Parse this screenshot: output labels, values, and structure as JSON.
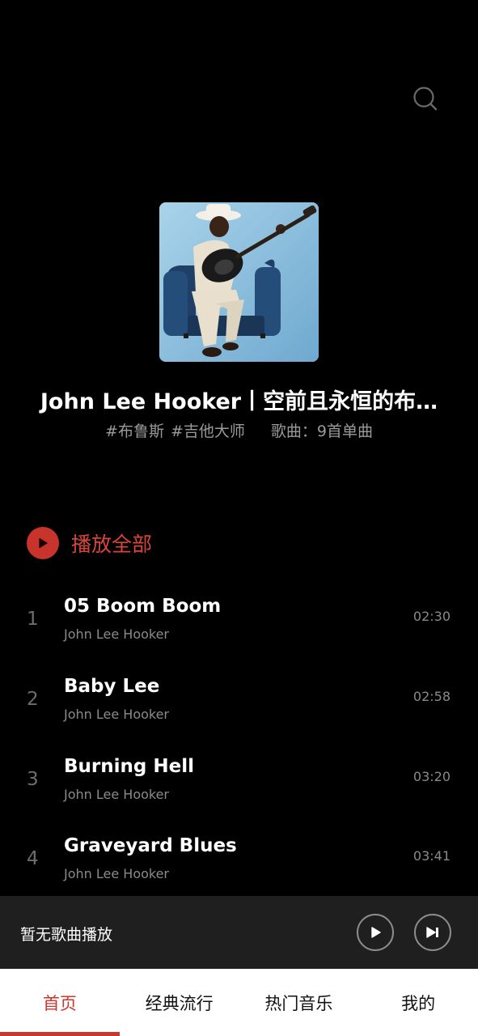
{
  "header": {
    "search_icon": "search-icon"
  },
  "playlist": {
    "title": "John Lee Hooker丨空前且永恒的布…",
    "tags": [
      "#布鲁斯",
      "#吉他大师"
    ],
    "song_count": "歌曲：9首单曲",
    "cover_icon": "album-cover-guitarist"
  },
  "play_all": {
    "label": "播放全部",
    "icon": "play-icon"
  },
  "tracks": [
    {
      "index": "1",
      "title": "05 Boom Boom",
      "artist": "John Lee Hooker",
      "duration": "02:30"
    },
    {
      "index": "2",
      "title": "Baby Lee",
      "artist": "John Lee Hooker",
      "duration": "02:58"
    },
    {
      "index": "3",
      "title": "Burning Hell",
      "artist": "John Lee Hooker",
      "duration": "03:20"
    },
    {
      "index": "4",
      "title": "Graveyard Blues",
      "artist": "John Lee Hooker",
      "duration": "03:41"
    }
  ],
  "player": {
    "status": "暂无歌曲播放",
    "play_icon": "play-icon",
    "next_icon": "skip-next-icon"
  },
  "tabs": [
    {
      "label": "首页",
      "active": true
    },
    {
      "label": "经典流行",
      "active": false
    },
    {
      "label": "热门音乐",
      "active": false
    },
    {
      "label": "我的",
      "active": false
    }
  ],
  "colors": {
    "accent": "#c9362d",
    "background": "#000000",
    "player_bar": "#1f1f1f"
  }
}
